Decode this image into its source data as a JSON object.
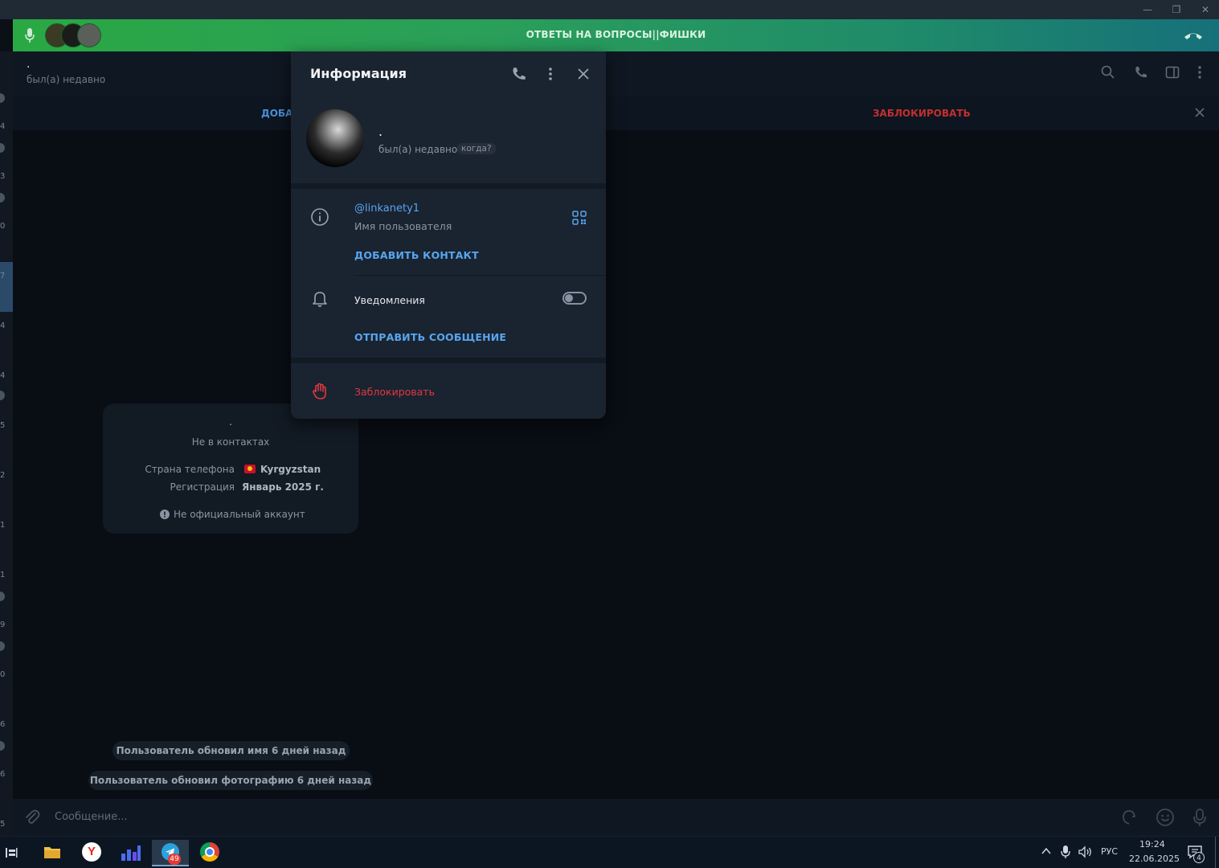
{
  "window": {
    "minimize": "—",
    "restore": "❐",
    "close": "✕"
  },
  "call_bar": {
    "title": "ОТВЕТЫ НА ВОПРОСЫ||ФИШКИ"
  },
  "chat_header": {
    "name": ".",
    "status": "был(а) недавно"
  },
  "action_bar": {
    "add_contact": "ДОБА",
    "block": "ЗАБЛОКИРОВАТЬ"
  },
  "left_strip": {
    "numbers": [
      "4",
      "3",
      "0",
      "7",
      "4",
      "4",
      "5",
      "2",
      "1",
      "1",
      "9",
      "0",
      "6",
      "6",
      "5"
    ]
  },
  "info_card": {
    "name": ".",
    "subtitle": "Не в контактах",
    "phone_country_label": "Страна телефона",
    "phone_country_value": "Kyrgyzstan",
    "registration_label": "Регистрация",
    "registration_value": "Январь 2025 г.",
    "unofficial": "Не официальный аккаунт"
  },
  "service_messages": [
    "Пользователь обновил имя 6 дней назад",
    "Пользователь обновил фотографию 6 дней назад"
  ],
  "composer": {
    "placeholder": "Сообщение..."
  },
  "panel": {
    "title": "Информация",
    "profile_name": ".",
    "profile_status": "был(а) недавно",
    "when_label": "когда?",
    "username": "@linkanety1",
    "username_caption": "Имя пользователя",
    "add_contact": "ДОБАВИТЬ КОНТАКТ",
    "notifications_label": "Уведомления",
    "notifications_on": false,
    "send_message": "ОТПРАВИТЬ СООБЩЕНИЕ",
    "block": "Заблокировать"
  },
  "taskbar": {
    "telegram_badge": "49",
    "language": "РУС",
    "time": "19:24",
    "date": "22.06.2025",
    "notif_count": "4"
  },
  "colors": {
    "accent": "#57a6f0",
    "danger": "#e0393e",
    "call_green": "#2aa843"
  }
}
